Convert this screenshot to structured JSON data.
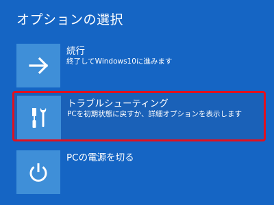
{
  "page": {
    "title": "オプションの選択",
    "background_color": "#1565c4"
  },
  "options": [
    {
      "label": "続行",
      "description": "終了してWindows10に進みます",
      "icon": "arrow-right-icon",
      "selected": false
    },
    {
      "label": "トラブルシューティング",
      "description": "PCを初期状態に戻すか、詳細オプションを表示します",
      "icon": "tools-icon",
      "selected": true,
      "highlight_color": "#e2101e"
    },
    {
      "label": "PCの電源を切る",
      "description": "",
      "icon": "power-icon",
      "selected": false
    }
  ],
  "colors": {
    "tile": "#3f8fd8",
    "text": "#ffffff"
  }
}
